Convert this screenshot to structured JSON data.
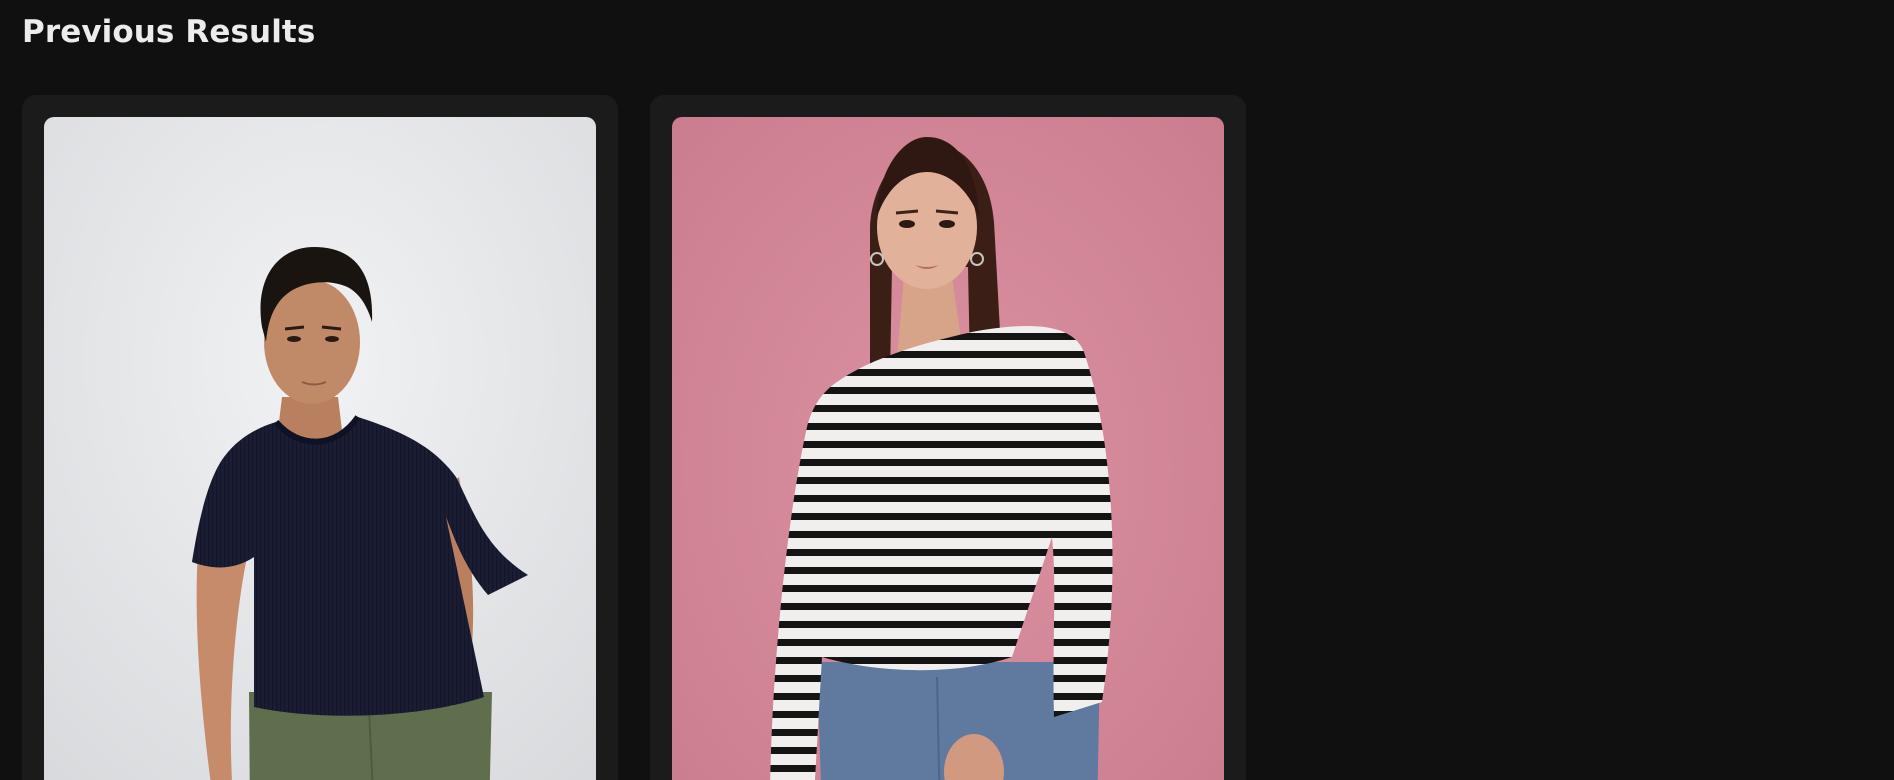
{
  "header": {
    "title": "Previous Results"
  },
  "results": [
    {
      "photo_icon": "person-photo-icon",
      "background_color": "#e5e6e8",
      "garment": "navy ribbed t-shirt",
      "garment_color": "#1b1d33",
      "pants_color": "#5f6f4d"
    },
    {
      "photo_icon": "person-photo-icon",
      "background_color": "#d48898",
      "garment": "black and white striped long-sleeve top",
      "garment_color": "#f1efee",
      "pants_color": "#5f7a9e"
    }
  ],
  "colors": {
    "page_background": "#101010",
    "card_background": "#1b1b1b",
    "title_text": "#ececec"
  }
}
